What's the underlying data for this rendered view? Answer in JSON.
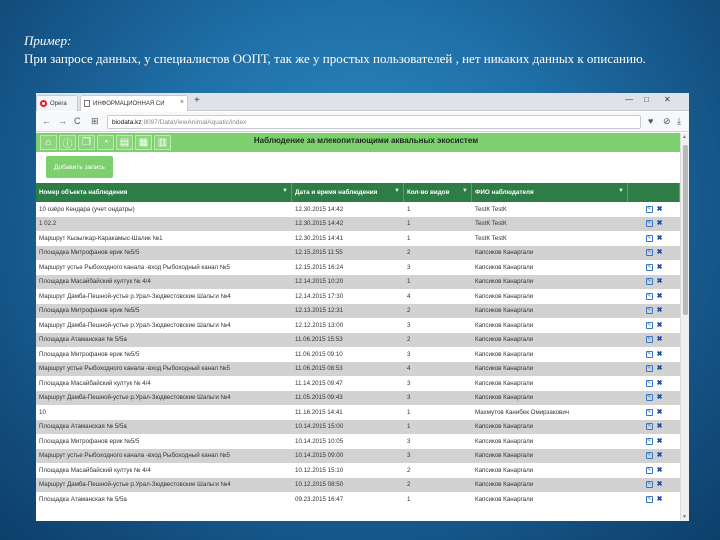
{
  "slide": {
    "title": "Пример:",
    "text": "При запросе данных, у специалистов ООПТ, так же у простых пользователей , нет никаких данных к описанию."
  },
  "browser": {
    "tabs": [
      {
        "label": "Opera",
        "icon": "opera-logo"
      },
      {
        "label": "ИНФОРМАЦИОННАЯ СИ",
        "icon": "document-icon",
        "close": "×"
      }
    ],
    "new_tab": "+",
    "window_controls": [
      "—",
      "□",
      "✕"
    ],
    "nav": {
      "back": "←",
      "forward": "→",
      "reload": "C",
      "speed_dial": "⊞"
    },
    "url": {
      "secure": "Не защищено",
      "host": "biodata.kz",
      "path": ":8097/DataViewAnimalAquatic/index"
    },
    "right_icons": [
      "♥",
      "⊘",
      "⤓"
    ]
  },
  "toolbar": {
    "icons": [
      "home-icon",
      "info-icon",
      "book-icon",
      "chart-icon",
      "document-icon",
      "table-icon",
      "bar-chart-icon"
    ],
    "title": "Наблюдение за млекопитающими аквальных экосистем",
    "color": "#7ed06f"
  },
  "add_button": "Добавить запись",
  "table": {
    "header_color": "#2e7d46",
    "columns": [
      "Номер объекта наблюдения",
      "Дата и время наблюдения",
      "Кол-во видов",
      "ФИО наблюдателя",
      ""
    ],
    "rows": [
      [
        "10 озёро Кендара (учет ондатры)",
        "12.30.2015 14:42",
        "1",
        "TestК TestК"
      ],
      [
        "1 02.2",
        "12.30.2015 14:42",
        "1",
        "TestК TestК"
      ],
      [
        "Маршрут Кызылкар-Каракамыс-Шалик №1",
        "12.30.2015 14:41",
        "1",
        "TestК TestК"
      ],
      [
        "Площадка Митрофанов ерик №5/5",
        "12.15.2015 11:55",
        "2",
        "Капсиков Канаргали"
      ],
      [
        "Маршрут устье Рыбоходного канала -вход Рыбоходный канал №5",
        "12.15.2015 16:24",
        "3",
        "Капсиков Канаргали"
      ],
      [
        "Площадка Масайбайский култук № 4/4",
        "12.14.2015 10:20",
        "1",
        "Капсиков Канаргали"
      ],
      [
        "Маршрут Дамба-Пешной-устье р.Урал-Зюдвестовские Шальги №4",
        "12.14.2015 17:30",
        "4",
        "Капсиков Канаргали"
      ],
      [
        "Площадка Митрофанов ерик №5/5",
        "12.13.2015 12:31",
        "2",
        "Капсиков Канаргали"
      ],
      [
        "Маршрут Дамба-Пешной-устье р.Урал-Зюдвестовские Шальги №4",
        "12.12.2015 13:00",
        "3",
        "Капсиков Канаргали"
      ],
      [
        "Площадка Атаманская № 5/5а",
        "11.06.2015 15:53",
        "2",
        "Капсиков Канаргали"
      ],
      [
        "Площадка Митрофанов ерик №5/5",
        "11.06.2015 09:10",
        "3",
        "Капсиков Канаргали"
      ],
      [
        "Маршрут устье Рыбоходного канала -вход Рыбоходный канал №5",
        "11.06.2015 08:53",
        "4",
        "Капсиков Канаргали"
      ],
      [
        "Площадка Масайбайский култук № 4/4",
        "11.14.2015 09:47",
        "3",
        "Капсиков Канаргали"
      ],
      [
        "Маршрут Дамба-Пешной-устье р.Урал-Зюдвестовские Шальги №4",
        "11.05.2015 09:43",
        "3",
        "Капсиков Канаргали"
      ],
      [
        "10",
        "11.16.2015 14:41",
        "1",
        "Махмутов Канибек Омирзакович"
      ],
      [
        "Площадка Атаманская № 5/5а",
        "10.14.2015 15:00",
        "1",
        "Капсиков Канаргали"
      ],
      [
        "Площадка Митрофанов ерик №5/5",
        "10.14.2015 10:05",
        "3",
        "Капсиков Канаргали"
      ],
      [
        "Маршрут устье Рыбоходного канала -вход Рыбоходный канал №5",
        "10.14.2015 09:00",
        "3",
        "Капсиков Канаргали"
      ],
      [
        "Площадка Масайбайский култук № 4/4",
        "10.12.2015 15:10",
        "2",
        "Капсиков Канаргали"
      ],
      [
        "Маршрут Дамба-Пешной-устье р.Урал-Зюдвестовские Шальги №4",
        "10.12.2015 08:50",
        "2",
        "Капсиков Канаргали"
      ],
      [
        "Площадка Атаманская № 5/5а",
        "09.23.2015 16:47",
        "1",
        "Капсиков Канаргали"
      ]
    ],
    "row_actions": {
      "edit": "✎",
      "delete": "✖"
    }
  }
}
